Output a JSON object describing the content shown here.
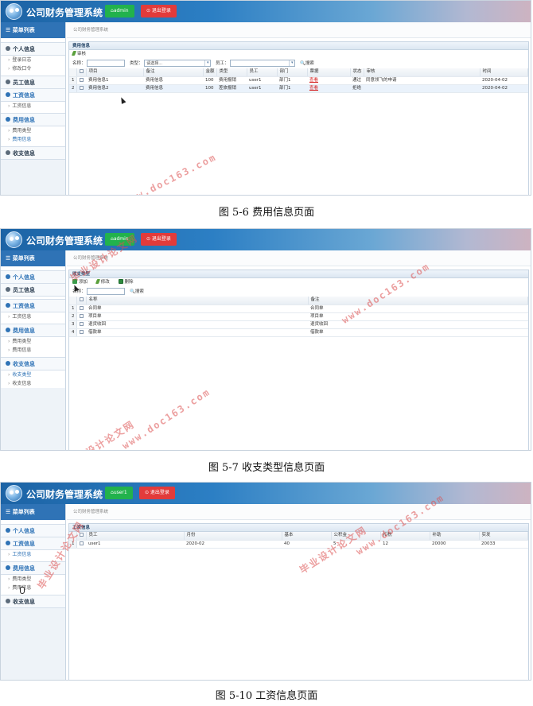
{
  "app_title": "公司财务管理系统",
  "logout_label": "⊙ 退出登录",
  "menu_title": "菜单列表",
  "breadcrumb": "公司财务管理系统",
  "captions": {
    "fig6": "图 5-6 费用信息页面",
    "fig7": "图 5-7 收支类型信息页面",
    "fig10": "图 5-10 工资信息页面"
  },
  "watermarks": {
    "site": "www.doc163.com",
    "cn": "毕业设计论文网"
  },
  "screen1": {
    "user_label": "admin",
    "panel_title": "费用信息",
    "toolbar": {
      "audit": "审核"
    },
    "search": {
      "name_label": "名称：",
      "type_label": "类型：",
      "type_value": "请选择...",
      "staff_label": "员工：",
      "search_btn": "搜索"
    },
    "menu": [
      {
        "label": "个人信息",
        "subs": [
          "登录日志",
          "修改口令"
        ]
      },
      {
        "label": "员工信息",
        "subs": []
      },
      {
        "label": "工资信息",
        "subs": [
          "工资信息"
        ]
      },
      {
        "label": "费用信息",
        "subs": [
          "费用类型",
          "费用信息"
        ]
      },
      {
        "label": "收支信息",
        "subs": []
      }
    ],
    "columns": [
      "",
      "",
      "项目",
      "备注",
      "金额",
      "类型",
      "员工",
      "部门",
      "票据",
      "状态",
      "审核",
      "时间"
    ],
    "rows": [
      [
        "1",
        "",
        "费用信息1",
        "费用信息",
        "100",
        "费用报销",
        "user1",
        "部门1",
        "查看",
        "通过",
        "同意领飞的申请",
        "2020-04-02"
      ],
      [
        "2",
        "",
        "费用信息2",
        "费用信息",
        "100",
        "差旅报销",
        "user1",
        "部门1",
        "查看",
        "拒绝",
        "",
        "2020-04-02"
      ]
    ]
  },
  "screen2": {
    "user_label": "admin",
    "panel_title": "收支类型",
    "toolbar": {
      "add": "添加",
      "edit": "修改",
      "delete": "删除"
    },
    "search": {
      "name_label": "名称：",
      "search_btn": "搜索"
    },
    "menu": [
      {
        "label": "个人信息",
        "subs": []
      },
      {
        "label": "员工信息",
        "subs": []
      },
      {
        "label": "工资信息",
        "subs": [
          "工资信息"
        ]
      },
      {
        "label": "费用信息",
        "subs": [
          "费用类型",
          "费用信息"
        ]
      },
      {
        "label": "收支信息",
        "subs": [
          "收支类型",
          "收支信息"
        ]
      }
    ],
    "columns": [
      "",
      "",
      "名称",
      "备注"
    ],
    "rows": [
      [
        "1",
        "",
        "合同单",
        "合同单"
      ],
      [
        "2",
        "",
        "项目单",
        "项目单"
      ],
      [
        "3",
        "",
        "退货收回",
        "退货收回"
      ],
      [
        "4",
        "",
        "借款单",
        "借款单"
      ]
    ]
  },
  "screen3": {
    "user_label": "user1",
    "panel_title": "工资信息",
    "menu": [
      {
        "label": "个人信息",
        "subs": []
      },
      {
        "label": "工资信息",
        "subs": [
          "工资信息"
        ]
      },
      {
        "label": "费用信息",
        "subs": [
          "费用类型",
          "费用信息"
        ]
      },
      {
        "label": "收支信息",
        "subs": []
      }
    ],
    "columns": [
      "",
      "",
      "员工",
      "月份",
      "基本",
      "公积金",
      "扣税",
      "补助",
      "实发"
    ],
    "rows": [
      [
        "1",
        "",
        "user1",
        "2020-02",
        "40",
        "5",
        "12",
        "20000",
        "20033"
      ]
    ]
  }
}
